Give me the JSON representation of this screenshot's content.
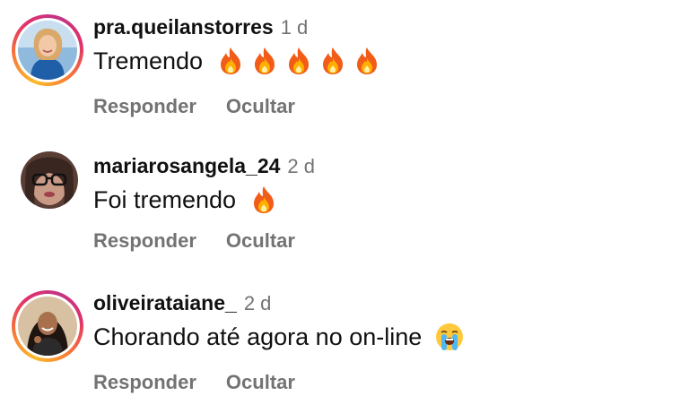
{
  "comments": [
    {
      "username": "pra.queilanstorres",
      "time": "1 d",
      "text": "Tremendo",
      "emojis": [
        "fire-icon",
        "fire-icon",
        "fire-icon",
        "fire-icon",
        "fire-icon"
      ],
      "story_ring": true,
      "reply_label": "Responder",
      "hide_label": "Ocultar"
    },
    {
      "username": "mariarosangela_24",
      "time": "2 d",
      "text": "Foi tremendo",
      "emojis": [
        "fire-icon"
      ],
      "story_ring": false,
      "reply_label": "Responder",
      "hide_label": "Ocultar"
    },
    {
      "username": "oliveirataiane_",
      "time": "2 d",
      "text": "Chorando até agora no on-line",
      "emojis": [
        "loudly-crying-face-icon"
      ],
      "story_ring": true,
      "reply_label": "Responder",
      "hide_label": "Ocultar"
    }
  ],
  "colors": {
    "text": "#111111",
    "secondary": "#737373",
    "ring_gradient": [
      "#fdbb2d",
      "#f77737",
      "#e1306c",
      "#c13584"
    ]
  }
}
